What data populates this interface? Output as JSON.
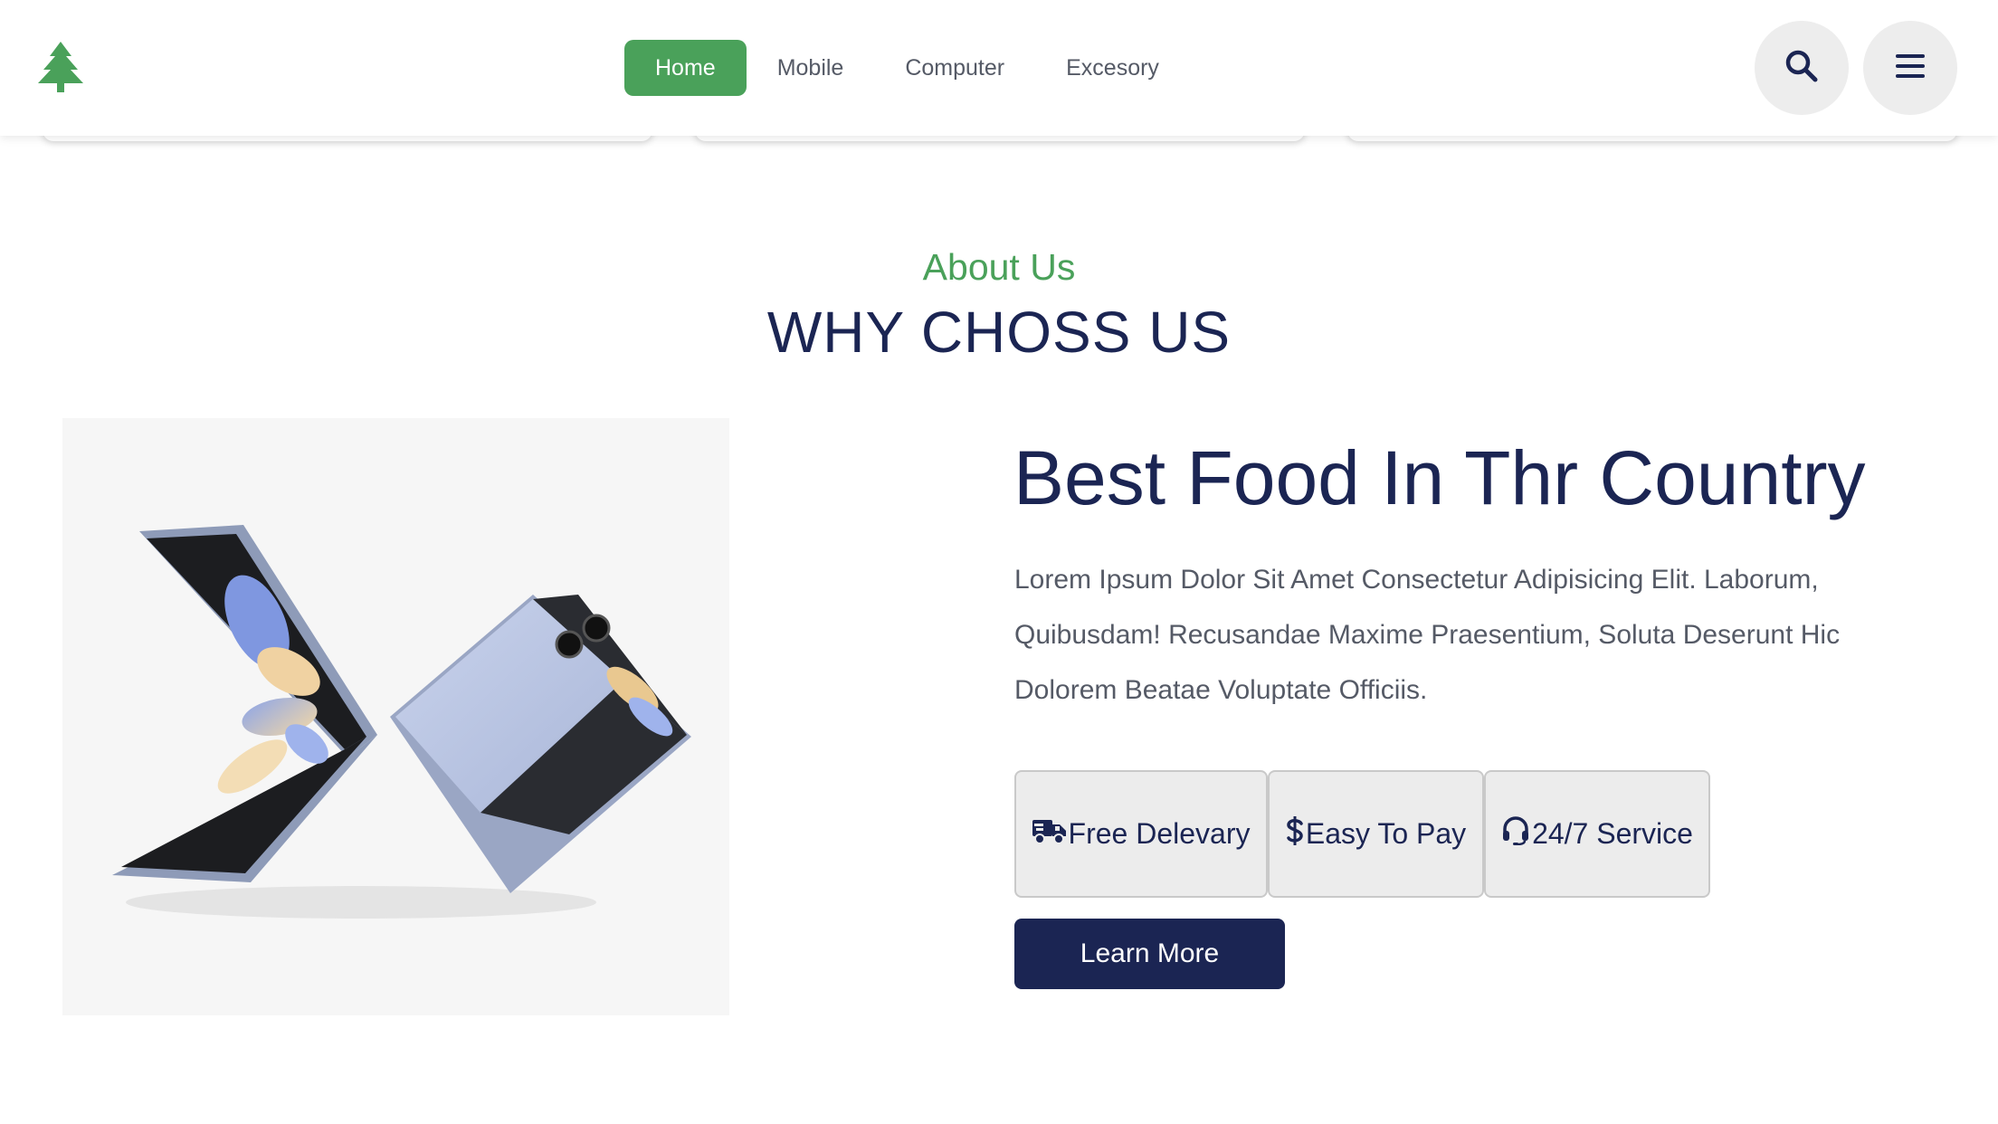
{
  "colors": {
    "accent_green": "#4aa15a",
    "navy": "#1b2553",
    "body_text": "#555a66",
    "button_gray": "#ececec"
  },
  "header": {
    "logo_icon": "tree-icon",
    "nav": [
      {
        "label": "Home",
        "active": true
      },
      {
        "label": "Mobile",
        "active": false
      },
      {
        "label": "Computer",
        "active": false
      },
      {
        "label": "Excesory",
        "active": false
      }
    ],
    "search_icon": "search-icon",
    "menu_icon": "hamburger-menu-icon"
  },
  "about": {
    "label": "About Us",
    "title": "WHY CHOSS US"
  },
  "content": {
    "image_alt_icon": "foldable-phone-image",
    "heading": "Best Food In Thr Country",
    "paragraph_lines": [
      "Lorem Ipsum Dolor Sit Amet Consectetur Adipisicing Elit. Laborum,",
      "Quibusdam! Recusandae Maxime Praesentium, Soluta Deserunt Hic",
      "Dolorem Beatae Voluptate Officiis."
    ],
    "features": [
      {
        "icon": "truck-icon",
        "label": "Free Delevary"
      },
      {
        "icon": "dollar-icon",
        "label": "Easy To Pay"
      },
      {
        "icon": "headset-icon",
        "label": "24/7 Service"
      }
    ],
    "cta_label": "Learn More"
  }
}
